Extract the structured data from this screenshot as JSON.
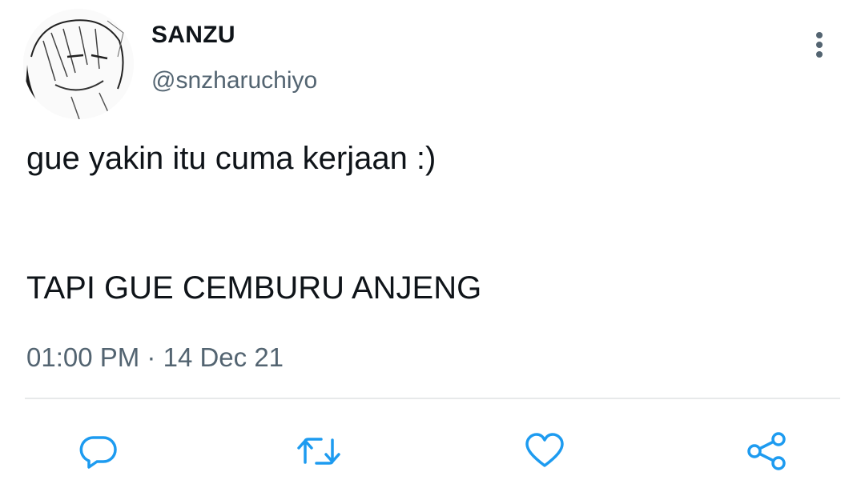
{
  "author": {
    "display_name": "SANZU",
    "handle": "@snzharuchiyo",
    "avatar_icon": "manga-portrait-avatar"
  },
  "tweet": {
    "line1": "gue yakin itu cuma kerjaan :)",
    "line2": "TAPI GUE CEMBURU ANJENG",
    "time": "01:00 PM",
    "separator": "·",
    "date": "14 Dec 21"
  },
  "actions": {
    "reply_icon": "reply-icon",
    "retweet_icon": "retweet-icon",
    "like_icon": "heart-icon",
    "share_icon": "share-icon",
    "more_icon": "more-vertical-icon"
  },
  "colors": {
    "text_primary": "#0f1419",
    "text_secondary": "#536471",
    "action_icon": "#1d9bf0",
    "divider": "#e7e9ea"
  }
}
